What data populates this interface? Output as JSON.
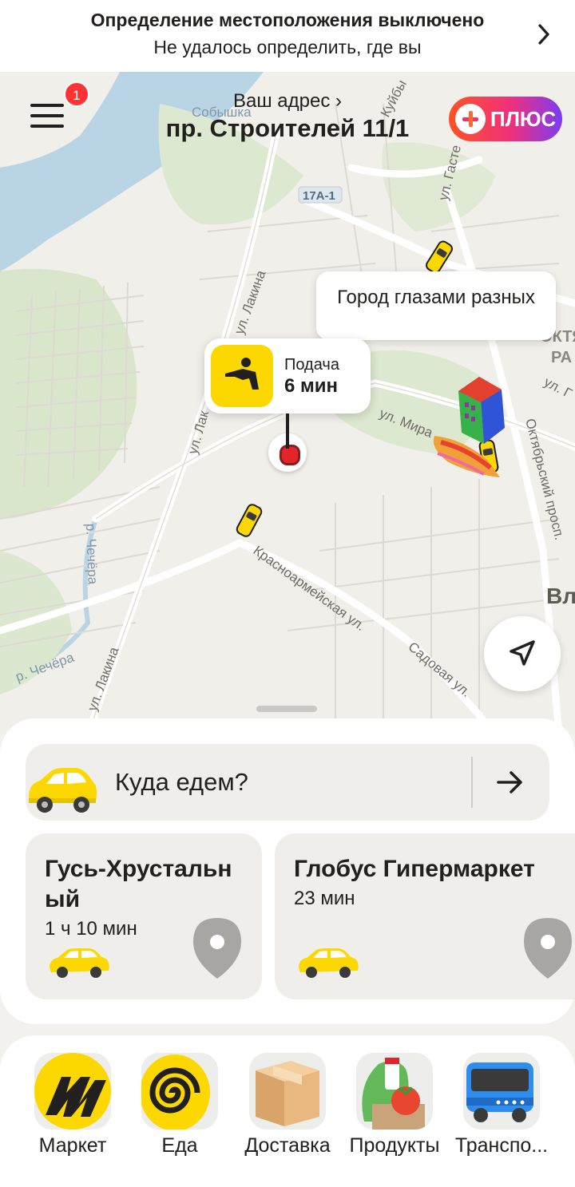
{
  "banner": {
    "title": "Определение местоположения выключено",
    "subtitle": "Не удалось определить, где вы",
    "chevron_icon": "chevron-right-icon"
  },
  "header": {
    "menu_badge": "1",
    "address_label": "Ваш адрес ›",
    "address_value": "пр. Строителей 11/1",
    "plus_label": "ПЛЮС"
  },
  "map": {
    "labels": {
      "sobyshka": "Собышка",
      "kuybysheva": "Куйбы",
      "gastello": "ул. Гасте",
      "route": "17А-1",
      "lakina_top": "ул. Лакина",
      "lakina_mid": "ул. Лак",
      "lakina_bottom": "ул. Лакина",
      "mira": "ул. Мира",
      "oktyabrsky": "Октябрьский просп.",
      "krasnoarmeyskaya": "Красноармейская ул.",
      "sadovaya": "Садовая ул.",
      "chechera_river": "р. Чечёра",
      "chechera_river2": "р. Чечёра",
      "vl": "Вл",
      "oktyab": "ОКТЯБ",
      "ra": "РА",
      "ul_g": "ул. Г"
    },
    "city_bubble": "Город глазами разных",
    "pickup_label": "Подача",
    "pickup_time": "6 мин"
  },
  "sheet": {
    "where_prompt": "Куда едем?",
    "destinations": [
      {
        "title": "Гусь-Хрустальный",
        "title_line1": "Гусь-Хрустальн",
        "title_line2": "ый",
        "time": "1 ч 10 мин"
      },
      {
        "title": "Глобус Гипермаркет",
        "time": "23 мин"
      }
    ]
  },
  "services": [
    {
      "label": "Маркет",
      "icon": "market-icon"
    },
    {
      "label": "Еда",
      "icon": "food-icon"
    },
    {
      "label": "Доставка",
      "icon": "delivery-box-icon"
    },
    {
      "label": "Продукты",
      "icon": "groceries-icon"
    },
    {
      "label": "Транспо...",
      "icon": "bus-icon"
    }
  ],
  "colors": {
    "taxi_yellow": "#fcd800",
    "plus_gradient": [
      "#ff5226",
      "#f0307c",
      "#7a3cf5"
    ],
    "pin_red": "#e0262a",
    "sheet_card": "#efeeeb"
  }
}
